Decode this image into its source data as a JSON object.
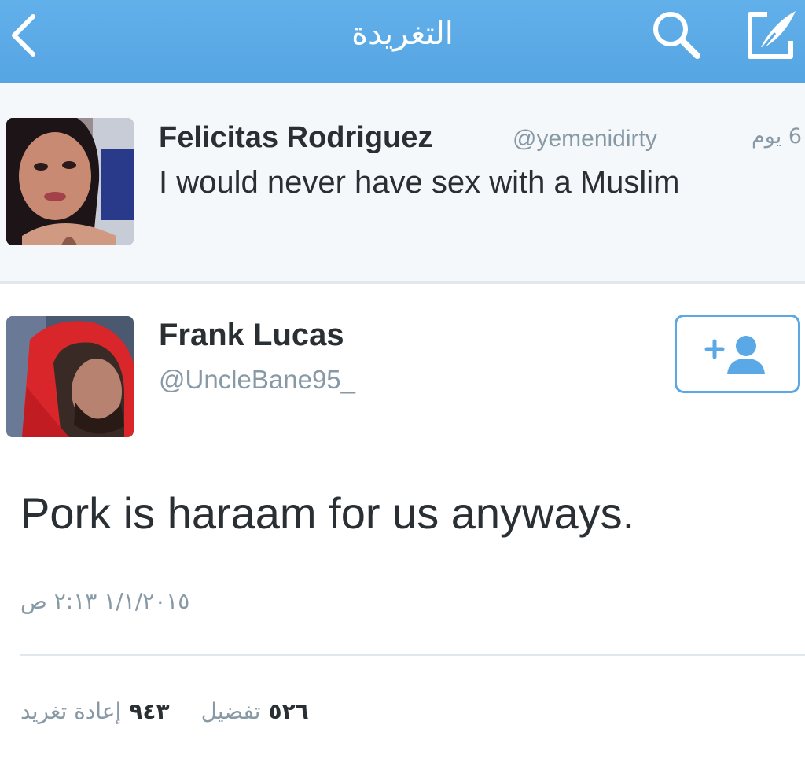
{
  "topbar": {
    "title": "التغريدة",
    "back_icon": "chevron-left-icon",
    "search_icon": "search-icon",
    "compose_icon": "compose-icon",
    "color": "#5aa9e6"
  },
  "parent_tweet": {
    "author_name": "Felicitas Rodriguez",
    "author_handle": "@yemenidirty",
    "time_ago": "6 يوم",
    "text": "I would never have sex with a Muslim"
  },
  "main_tweet": {
    "author_name": "Frank Lucas",
    "author_handle": "@UncleBane95_",
    "follow_icon": "add-user-icon",
    "text": "Pork is haraam for us anyways.",
    "timestamp": "١/١/٢٠١٥ ٢:١٣ ص",
    "retweets_count": "٩٤٣",
    "retweets_label": "إعادة تغريد",
    "favorites_count": "٥٢٦",
    "favorites_label": "تفضيل"
  },
  "colors": {
    "accent": "#5aa9e6",
    "text": "#292f33",
    "secondary_text": "#8899a6",
    "parent_background": "#f5f8fa"
  }
}
